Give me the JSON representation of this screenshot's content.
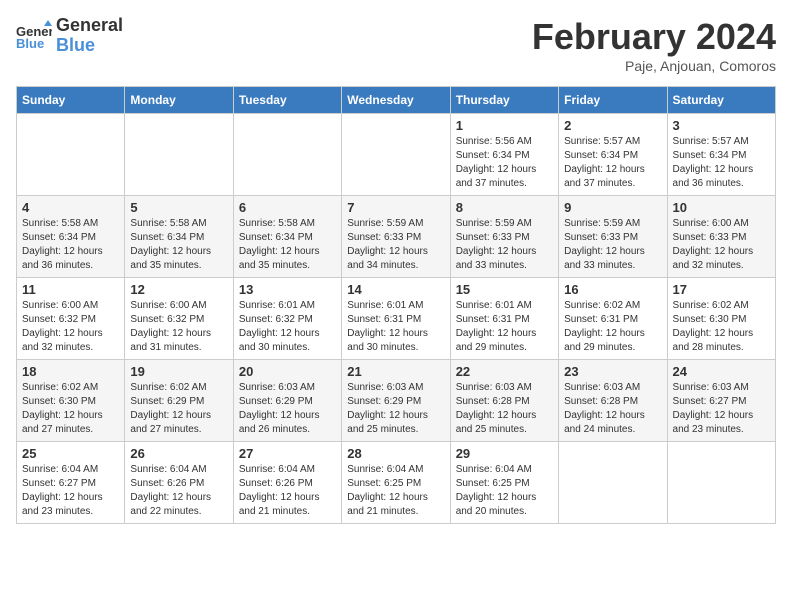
{
  "header": {
    "logo_line1": "General",
    "logo_line2": "Blue",
    "month_title": "February 2024",
    "location": "Paje, Anjouan, Comoros"
  },
  "days_of_week": [
    "Sunday",
    "Monday",
    "Tuesday",
    "Wednesday",
    "Thursday",
    "Friday",
    "Saturday"
  ],
  "weeks": [
    [
      {
        "day": "",
        "info": ""
      },
      {
        "day": "",
        "info": ""
      },
      {
        "day": "",
        "info": ""
      },
      {
        "day": "",
        "info": ""
      },
      {
        "day": "1",
        "info": "Sunrise: 5:56 AM\nSunset: 6:34 PM\nDaylight: 12 hours\nand 37 minutes."
      },
      {
        "day": "2",
        "info": "Sunrise: 5:57 AM\nSunset: 6:34 PM\nDaylight: 12 hours\nand 37 minutes."
      },
      {
        "day": "3",
        "info": "Sunrise: 5:57 AM\nSunset: 6:34 PM\nDaylight: 12 hours\nand 36 minutes."
      }
    ],
    [
      {
        "day": "4",
        "info": "Sunrise: 5:58 AM\nSunset: 6:34 PM\nDaylight: 12 hours\nand 36 minutes."
      },
      {
        "day": "5",
        "info": "Sunrise: 5:58 AM\nSunset: 6:34 PM\nDaylight: 12 hours\nand 35 minutes."
      },
      {
        "day": "6",
        "info": "Sunrise: 5:58 AM\nSunset: 6:34 PM\nDaylight: 12 hours\nand 35 minutes."
      },
      {
        "day": "7",
        "info": "Sunrise: 5:59 AM\nSunset: 6:33 PM\nDaylight: 12 hours\nand 34 minutes."
      },
      {
        "day": "8",
        "info": "Sunrise: 5:59 AM\nSunset: 6:33 PM\nDaylight: 12 hours\nand 33 minutes."
      },
      {
        "day": "9",
        "info": "Sunrise: 5:59 AM\nSunset: 6:33 PM\nDaylight: 12 hours\nand 33 minutes."
      },
      {
        "day": "10",
        "info": "Sunrise: 6:00 AM\nSunset: 6:33 PM\nDaylight: 12 hours\nand 32 minutes."
      }
    ],
    [
      {
        "day": "11",
        "info": "Sunrise: 6:00 AM\nSunset: 6:32 PM\nDaylight: 12 hours\nand 32 minutes."
      },
      {
        "day": "12",
        "info": "Sunrise: 6:00 AM\nSunset: 6:32 PM\nDaylight: 12 hours\nand 31 minutes."
      },
      {
        "day": "13",
        "info": "Sunrise: 6:01 AM\nSunset: 6:32 PM\nDaylight: 12 hours\nand 30 minutes."
      },
      {
        "day": "14",
        "info": "Sunrise: 6:01 AM\nSunset: 6:31 PM\nDaylight: 12 hours\nand 30 minutes."
      },
      {
        "day": "15",
        "info": "Sunrise: 6:01 AM\nSunset: 6:31 PM\nDaylight: 12 hours\nand 29 minutes."
      },
      {
        "day": "16",
        "info": "Sunrise: 6:02 AM\nSunset: 6:31 PM\nDaylight: 12 hours\nand 29 minutes."
      },
      {
        "day": "17",
        "info": "Sunrise: 6:02 AM\nSunset: 6:30 PM\nDaylight: 12 hours\nand 28 minutes."
      }
    ],
    [
      {
        "day": "18",
        "info": "Sunrise: 6:02 AM\nSunset: 6:30 PM\nDaylight: 12 hours\nand 27 minutes."
      },
      {
        "day": "19",
        "info": "Sunrise: 6:02 AM\nSunset: 6:29 PM\nDaylight: 12 hours\nand 27 minutes."
      },
      {
        "day": "20",
        "info": "Sunrise: 6:03 AM\nSunset: 6:29 PM\nDaylight: 12 hours\nand 26 minutes."
      },
      {
        "day": "21",
        "info": "Sunrise: 6:03 AM\nSunset: 6:29 PM\nDaylight: 12 hours\nand 25 minutes."
      },
      {
        "day": "22",
        "info": "Sunrise: 6:03 AM\nSunset: 6:28 PM\nDaylight: 12 hours\nand 25 minutes."
      },
      {
        "day": "23",
        "info": "Sunrise: 6:03 AM\nSunset: 6:28 PM\nDaylight: 12 hours\nand 24 minutes."
      },
      {
        "day": "24",
        "info": "Sunrise: 6:03 AM\nSunset: 6:27 PM\nDaylight: 12 hours\nand 23 minutes."
      }
    ],
    [
      {
        "day": "25",
        "info": "Sunrise: 6:04 AM\nSunset: 6:27 PM\nDaylight: 12 hours\nand 23 minutes."
      },
      {
        "day": "26",
        "info": "Sunrise: 6:04 AM\nSunset: 6:26 PM\nDaylight: 12 hours\nand 22 minutes."
      },
      {
        "day": "27",
        "info": "Sunrise: 6:04 AM\nSunset: 6:26 PM\nDaylight: 12 hours\nand 21 minutes."
      },
      {
        "day": "28",
        "info": "Sunrise: 6:04 AM\nSunset: 6:25 PM\nDaylight: 12 hours\nand 21 minutes."
      },
      {
        "day": "29",
        "info": "Sunrise: 6:04 AM\nSunset: 6:25 PM\nDaylight: 12 hours\nand 20 minutes."
      },
      {
        "day": "",
        "info": ""
      },
      {
        "day": "",
        "info": ""
      }
    ]
  ]
}
